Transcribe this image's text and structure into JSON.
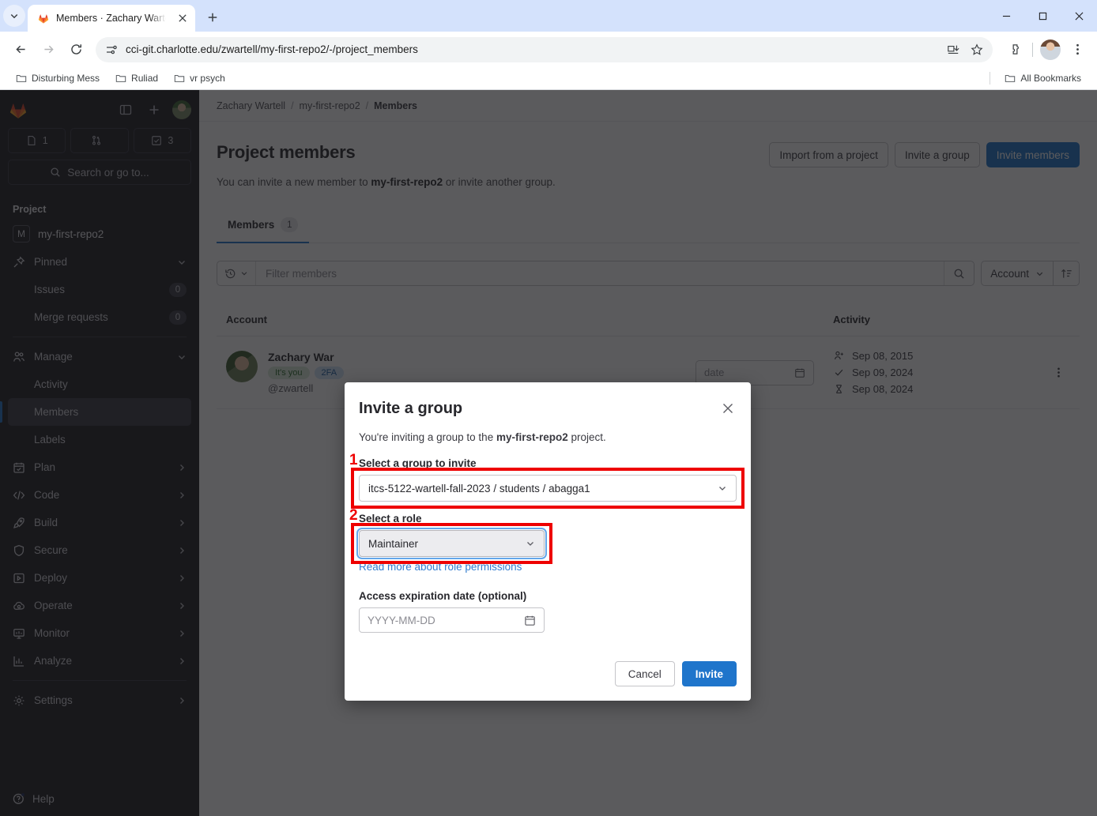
{
  "browser": {
    "tab": {
      "title": "Members · Zachary Wartell / my",
      "favicon": "gitlab-favicon"
    },
    "url": "cci-git.charlotte.edu/zwartell/my-first-repo2/-/project_members",
    "bookmarks": [
      "Disturbing Mess",
      "Ruliad",
      "vr psych"
    ],
    "all_bookmarks_label": "All Bookmarks"
  },
  "sidebar": {
    "counts": [
      {
        "icon": "issues-icon",
        "value": "1"
      },
      {
        "icon": "merge-request-icon",
        "value": ""
      },
      {
        "icon": "todo-icon",
        "value": "3"
      }
    ],
    "search_placeholder": "Search or go to...",
    "section_title": "Project",
    "project": {
      "initial": "M",
      "name": "my-first-repo2"
    },
    "items": [
      {
        "label": "Pinned",
        "icon": "pin-icon",
        "chevron": "down",
        "sub": false
      },
      {
        "label": "Issues",
        "icon": "",
        "badge": "0",
        "sub": true
      },
      {
        "label": "Merge requests",
        "icon": "",
        "badge": "0",
        "sub": true
      },
      {
        "label": "Manage",
        "icon": "users-icon",
        "chevron": "down",
        "sub": false
      },
      {
        "label": "Activity",
        "icon": "",
        "sub": true
      },
      {
        "label": "Members",
        "icon": "",
        "sub": true,
        "active": true
      },
      {
        "label": "Labels",
        "icon": "",
        "sub": true
      },
      {
        "label": "Plan",
        "icon": "calendar-icon",
        "chevron": "right",
        "sub": false
      },
      {
        "label": "Code",
        "icon": "code-icon",
        "chevron": "right",
        "sub": false
      },
      {
        "label": "Build",
        "icon": "rocket-icon",
        "chevron": "right",
        "sub": false
      },
      {
        "label": "Secure",
        "icon": "shield-icon",
        "chevron": "right",
        "sub": false
      },
      {
        "label": "Deploy",
        "icon": "deploy-icon",
        "chevron": "right",
        "sub": false
      },
      {
        "label": "Operate",
        "icon": "cloud-gear-icon",
        "chevron": "right",
        "sub": false
      },
      {
        "label": "Monitor",
        "icon": "monitor-icon",
        "chevron": "right",
        "sub": false
      },
      {
        "label": "Analyze",
        "icon": "chart-icon",
        "chevron": "right",
        "sub": false
      },
      {
        "label": "Settings",
        "icon": "gear-icon",
        "chevron": "right",
        "sub": false
      }
    ],
    "help_label": "Help"
  },
  "breadcrumb": {
    "items": [
      "Zachary Wartell",
      "my-first-repo2",
      "Members"
    ],
    "separator": "/"
  },
  "page": {
    "title": "Project members",
    "subtitle_pre": "You can invite a new member to ",
    "subtitle_bold": "my-first-repo2",
    "subtitle_post": " or invite another group.",
    "actions": [
      {
        "label": "Import from a project",
        "style": "secondary"
      },
      {
        "label": "Invite a group",
        "style": "secondary"
      },
      {
        "label": "Invite members",
        "style": "primary"
      }
    ],
    "tab": {
      "label": "Members",
      "count": "1"
    }
  },
  "filter": {
    "placeholder": "Filter members",
    "history_icon": "history-icon",
    "search_icon": "search-icon",
    "sort_field": "Account",
    "sort_direction_icon": "sort-ascending-icon"
  },
  "table": {
    "columns": {
      "account": "Account",
      "activity": "Activity"
    },
    "rows": [
      {
        "name": "Zachary War",
        "badges": [
          "It's you",
          "2FA"
        ],
        "handle": "@zwartell",
        "expiration_placeholder": "date",
        "activity": [
          {
            "icon": "user-add-icon",
            "date": "Sep 08, 2015"
          },
          {
            "icon": "check-icon",
            "date": "Sep 09, 2024"
          },
          {
            "icon": "hourglass-icon",
            "date": "Sep 08, 2024"
          }
        ]
      }
    ]
  },
  "modal": {
    "title": "Invite a group",
    "close_icon": "close-icon",
    "description_pre": "You're inviting a group to the ",
    "description_bold": "my-first-repo2",
    "description_post": " project.",
    "group_label": "Select a group to invite",
    "group_value": "itcs-5122-wartell-fall-2023 / students / abagga1",
    "role_label": "Select a role",
    "role_value": "Maintainer",
    "read_more_link": "Read more about role permissions",
    "expiration_label": "Access expiration date (optional)",
    "expiration_placeholder": "YYYY-MM-DD",
    "cancel_label": "Cancel",
    "invite_label": "Invite"
  },
  "annotations": {
    "step1": "1",
    "step2": "2",
    "color": "#ee0000"
  }
}
